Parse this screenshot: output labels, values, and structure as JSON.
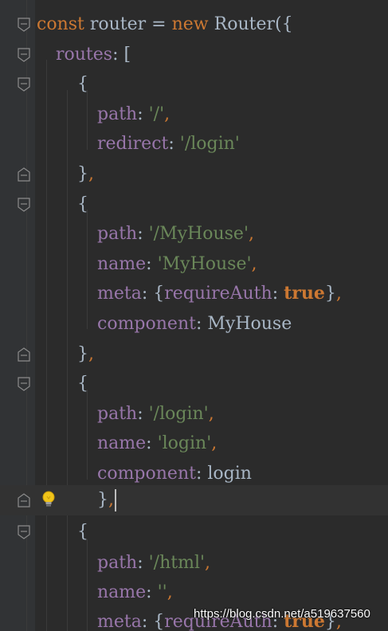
{
  "colors": {
    "background": "#2b2b2b",
    "keyword": "#cc7832",
    "property": "#9876aa",
    "string": "#6a8759",
    "identifier": "#a9b7c6"
  },
  "code": {
    "l1": {
      "kw1": "const",
      "t1": " router = ",
      "kw2": "new",
      "t2": " Router({"
    },
    "l2": {
      "prop": "routes",
      "t1": ": ["
    },
    "l3": {
      "t1": "{"
    },
    "l4": {
      "prop": "path",
      "t1": ": ",
      "str": "'/'",
      "comma": ","
    },
    "l5": {
      "prop": "redirect",
      "t1": ": ",
      "str": "'/login'"
    },
    "l6": {
      "t1": "}",
      "comma": ","
    },
    "l7": {
      "t1": "{"
    },
    "l8": {
      "prop": "path",
      "t1": ": ",
      "str": "'/MyHouse'",
      "comma": ","
    },
    "l9": {
      "prop": "name",
      "t1": ": ",
      "str": "'MyHouse'",
      "comma": ","
    },
    "l10": {
      "prop": "meta",
      "t1": ": {",
      "prop2": "requireAuth",
      "t2": ": ",
      "kw": "true",
      "t3": "}",
      "comma": ","
    },
    "l11": {
      "prop": "component",
      "t1": ": MyHouse"
    },
    "l12": {
      "t1": "}",
      "comma": ","
    },
    "l13": {
      "t1": "{"
    },
    "l14": {
      "prop": "path",
      "t1": ": ",
      "str": "'/login'",
      "comma": ","
    },
    "l15": {
      "prop": "name",
      "t1": ": ",
      "str": "'login'",
      "comma": ","
    },
    "l16": {
      "prop": "component",
      "t1": ": login"
    },
    "l17": {
      "t1": "}",
      "comma": ","
    },
    "l18": {
      "t1": "{"
    },
    "l19": {
      "prop": "path",
      "t1": ": ",
      "str": "'/html'",
      "comma": ","
    },
    "l20": {
      "prop": "name",
      "t1": ": ",
      "str": "''",
      "comma": ","
    },
    "l21": {
      "prop": "meta",
      "t1": ": {",
      "prop2": "requireAuth",
      "t2": ": ",
      "kw": "true",
      "t3": "}",
      "comma": ","
    }
  },
  "watermark": "https://blog.csdn.net/a519637560"
}
